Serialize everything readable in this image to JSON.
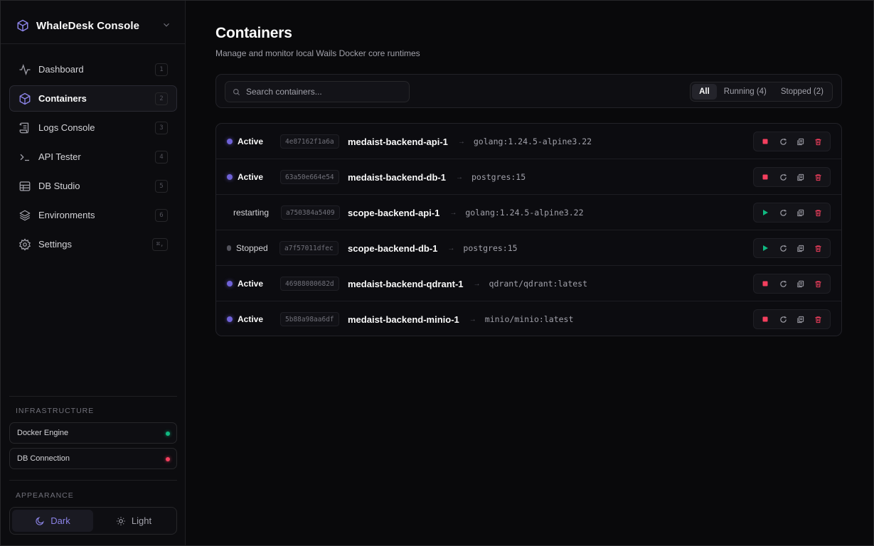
{
  "app": {
    "title": "WhaleDesk Console"
  },
  "sidebar": {
    "items": [
      {
        "label": "Dashboard",
        "shortcut": "1",
        "icon": "activity-icon"
      },
      {
        "label": "Containers",
        "shortcut": "2",
        "icon": "box-icon"
      },
      {
        "label": "Logs Console",
        "shortcut": "3",
        "icon": "scroll-icon"
      },
      {
        "label": "API Tester",
        "shortcut": "4",
        "icon": "terminal-icon"
      },
      {
        "label": "DB Studio",
        "shortcut": "5",
        "icon": "database-icon"
      },
      {
        "label": "Environments",
        "shortcut": "6",
        "icon": "layers-icon"
      },
      {
        "label": "Settings",
        "shortcut": "⌘,",
        "icon": "gear-icon"
      }
    ],
    "infrastructure": {
      "title": "INFRASTRUCTURE",
      "items": [
        {
          "label": "Docker Engine",
          "status_color": "#10b981"
        },
        {
          "label": "DB Connection",
          "status_color": "#f43f5e"
        }
      ]
    },
    "appearance": {
      "title": "APPEARANCE",
      "dark_label": "Dark",
      "light_label": "Light",
      "selected": "Dark"
    }
  },
  "main": {
    "title": "Containers",
    "subtitle": "Manage and monitor local Wails Docker core runtimes",
    "search": {
      "placeholder": "Search containers...",
      "value": ""
    },
    "filters": {
      "all": "All",
      "running": "Running (4)",
      "stopped": "Stopped (2)",
      "selected": "All"
    },
    "containers": [
      {
        "status": "Active",
        "id": "4e87162f1a6a",
        "name": "medaist-backend-api-1",
        "image": "golang:1.24.5-alpine3.22"
      },
      {
        "status": "Active",
        "id": "63a50e664e54",
        "name": "medaist-backend-db-1",
        "image": "postgres:15"
      },
      {
        "status": "restarting",
        "id": "a750384a5409",
        "name": "scope-backend-api-1",
        "image": "golang:1.24.5-alpine3.22"
      },
      {
        "status": "Stopped",
        "id": "a7f57011dfec",
        "name": "scope-backend-db-1",
        "image": "postgres:15"
      },
      {
        "status": "Active",
        "id": "46988080682d",
        "name": "medaist-backend-qdrant-1",
        "image": "qdrant/qdrant:latest"
      },
      {
        "status": "Active",
        "id": "5b88a98aa6df",
        "name": "medaist-backend-minio-1",
        "image": "minio/minio:latest"
      }
    ]
  },
  "colors": {
    "accent": "#6f62d8",
    "danger": "#f43f5e",
    "success": "#10b981",
    "background": "#09090b"
  }
}
